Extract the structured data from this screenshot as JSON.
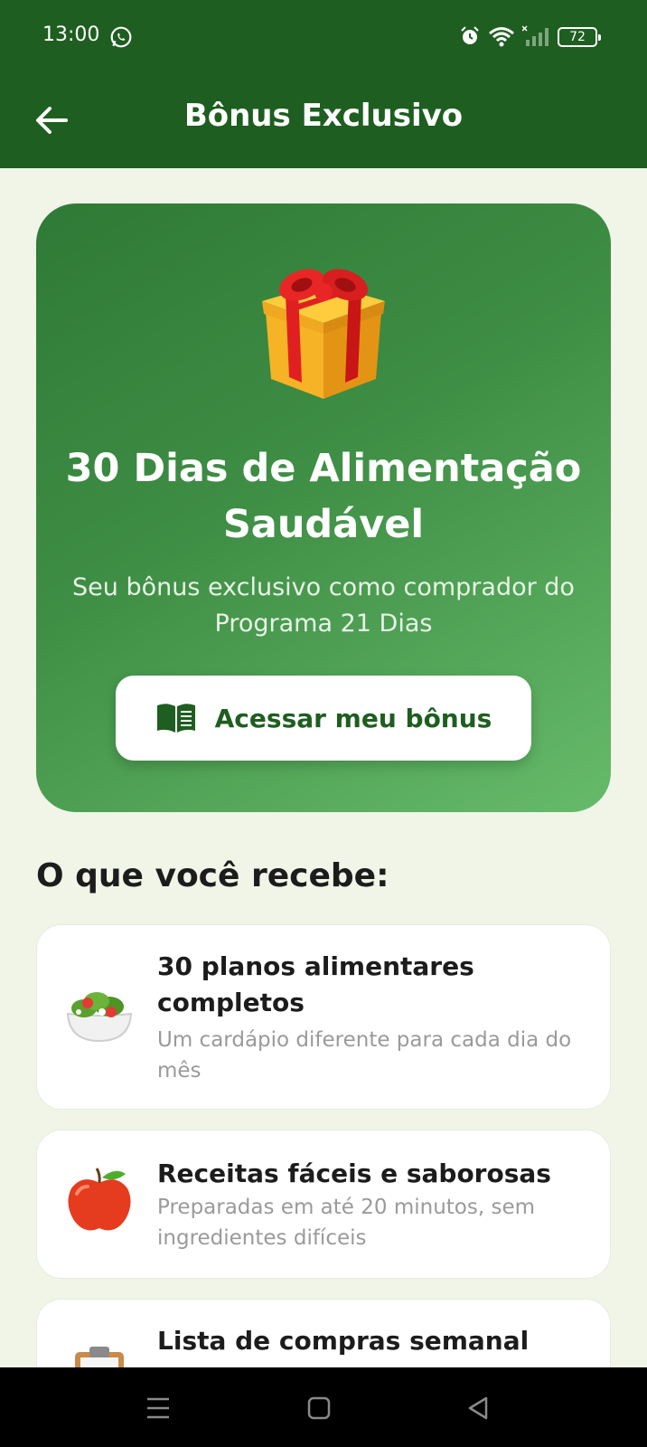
{
  "status_bar": {
    "time": "13:00",
    "battery": "72",
    "icons": [
      "whatsapp-icon",
      "alarm-icon",
      "wifi-icon",
      "signal-icon",
      "battery-icon"
    ]
  },
  "app_bar": {
    "title": "Bônus Exclusivo",
    "back_icon": "arrow-left-icon"
  },
  "hero": {
    "icon": "gift-icon",
    "title": "30 Dias de Alimentação Saudável",
    "subtitle": "Seu bônus exclusivo como comprador do Programa 21 Dias",
    "button_label": "Acessar meu bônus",
    "button_icon": "book-icon"
  },
  "section": {
    "title": "O que você recebe:",
    "features": [
      {
        "icon": "salad-icon",
        "title": "30 planos alimentares completos",
        "description": "Um cardápio diferente para cada dia do mês"
      },
      {
        "icon": "apple-icon",
        "title": "Receitas fáceis e saborosas",
        "description": "Preparadas em até 20 minutos, sem ingredientes difíceis"
      },
      {
        "icon": "clipboard-icon",
        "title": "Lista de compras semanal",
        "description": ""
      }
    ]
  },
  "colors": {
    "primary": "#1e5e20",
    "background": "#f0f5e8",
    "hero_gradient_start": "#2e7a36",
    "hero_gradient_end": "#66bb6a"
  },
  "nav_bar": {
    "buttons": [
      "menu-icon",
      "home-icon",
      "back-triangle-icon"
    ]
  }
}
